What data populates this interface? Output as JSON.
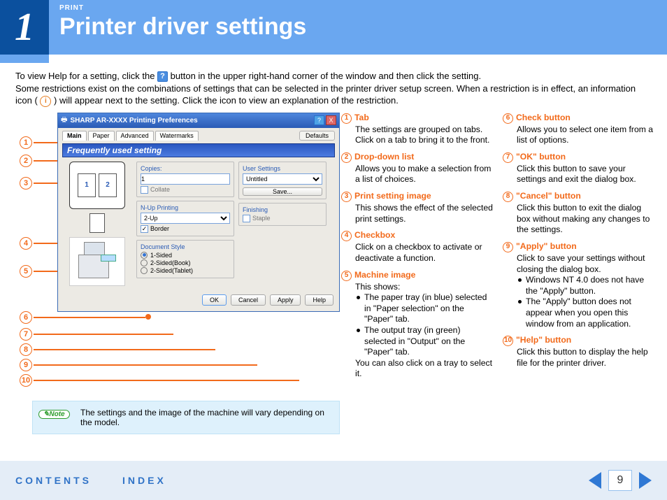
{
  "header": {
    "kicker": "PRINT",
    "title": "Printer driver settings",
    "step_number": "1"
  },
  "intro": {
    "line1a": "To view Help for a setting, click the ",
    "line1_help": "?",
    "line1b": " button in the upper right-hand corner of the window and then click the setting.",
    "line2a": "Some restrictions exist on the combinations of settings that can be selected in the printer driver setup screen. When a restriction is in effect, an information icon ( ",
    "line2_info": "i",
    "line2b": " ) will appear next to the setting. Click the icon to view an explanation of the restriction."
  },
  "dialog": {
    "title": "SHARP AR-XXXX Printing Preferences",
    "help_btn": "?",
    "close_btn": "X",
    "tabs": [
      "Main",
      "Paper",
      "Advanced",
      "Watermarks"
    ],
    "defaults_btn": "Defaults",
    "freq_bar": "Frequently used setting",
    "copies_label": "Copies:",
    "copies_value": "1",
    "collate_label": "Collate",
    "nup_label": "N-Up Printing",
    "nup_value": "2-Up",
    "border_label": "Border",
    "docstyle_label": "Document Style",
    "docstyle_opts": [
      "1-Sided",
      "2-Sided(Book)",
      "2-Sided(Tablet)"
    ],
    "usersettings_label": "User Settings",
    "usersettings_value": "Untitled",
    "save_btn": "Save...",
    "finishing_label": "Finishing",
    "staple_label": "Staple",
    "nup_preview": {
      "p1": "1",
      "p2": "2"
    },
    "footer": {
      "ok": "OK",
      "cancel": "Cancel",
      "apply": "Apply",
      "help": "Help"
    }
  },
  "callouts": [
    "1",
    "2",
    "3",
    "4",
    "5",
    "6",
    "7",
    "8",
    "9",
    "10"
  ],
  "note": {
    "pill": "Note",
    "text": "The settings and the image of the machine will vary depending on the model."
  },
  "desc_left": [
    {
      "n": "1",
      "title": "Tab",
      "body": "The settings are grouped on tabs. Click on a tab to bring it to the front."
    },
    {
      "n": "2",
      "title": "Drop-down list",
      "body": "Allows you to make a selection from a list of choices."
    },
    {
      "n": "3",
      "title": "Print setting image",
      "body": "This shows the effect of the selected print settings."
    },
    {
      "n": "4",
      "title": "Checkbox",
      "body": "Click on a checkbox to activate or deactivate a function."
    },
    {
      "n": "5",
      "title": "Machine image",
      "body_intro": "This shows:",
      "bullets": [
        "The paper tray (in blue) selected in \"Paper selection\" on the \"Paper\" tab.",
        "The output tray (in green) selected in \"Output\" on the \"Paper\" tab."
      ],
      "tail": "You can also click on a tray to select it."
    }
  ],
  "desc_right": [
    {
      "n": "6",
      "title": "Check button",
      "body": "Allows you to select one item from a list of options."
    },
    {
      "n": "7",
      "title": "\"OK\" button",
      "body": "Click this button to save your settings and exit the dialog box."
    },
    {
      "n": "8",
      "title": "\"Cancel\" button",
      "body": "Click this button to exit the dialog box without making any changes to the settings."
    },
    {
      "n": "9",
      "title": "\"Apply\" button",
      "body_intro": "Click to save your settings without closing the dialog box.",
      "bullets": [
        "Windows NT 4.0 does not have the \"Apply\" button.",
        "The \"Apply\" button does not appear when you open this window from an application."
      ]
    },
    {
      "n": "10",
      "title": "\"Help\" button",
      "body": "Click this button to display the help file for the printer driver."
    }
  ],
  "footer": {
    "contents": "CONTENTS",
    "index": "INDEX",
    "page": "9"
  }
}
